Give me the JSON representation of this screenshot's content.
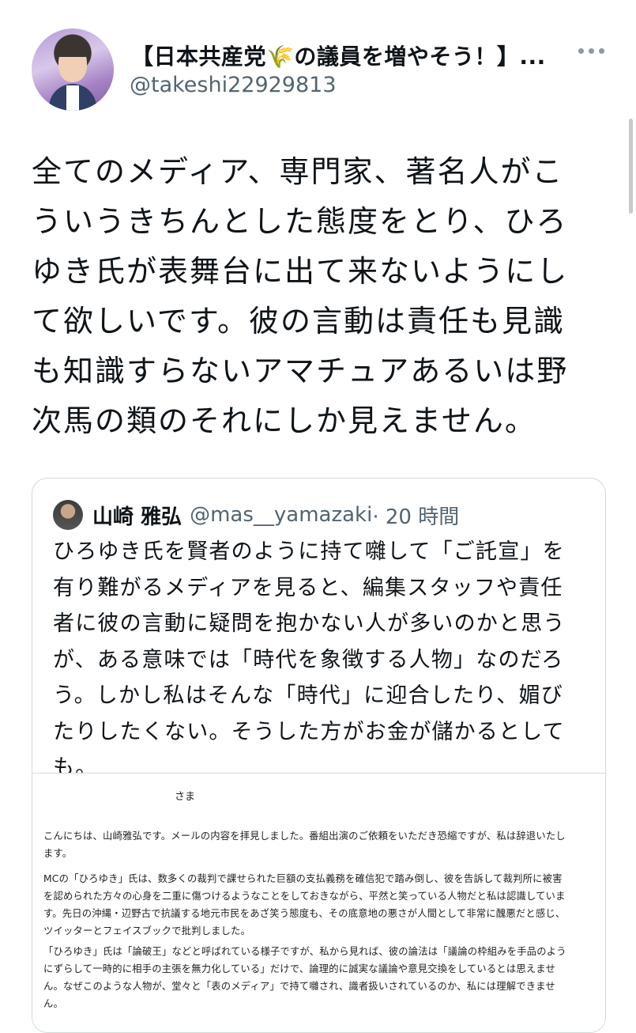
{
  "tweet": {
    "display_name_prefix": "【日本共産党",
    "display_name_emoji": "🌾",
    "display_name_suffix": "の議員を増やそう！】...",
    "handle": "@takeshi22929813",
    "text": "全てのメディア、専門家、著名人がこ\nういうきちんとした態度をとり、ひろ\nゆき氏が表舞台に出て来ないようにし\nて欲しいです。彼の言動は責任も見識\nも知識すらないアマチュアあるいは野\n次馬の類のそれにしか見えません。"
  },
  "quote": {
    "name": "山崎 雅弘",
    "handle": "@mas__yamazaki",
    "time": "· 20 時間",
    "text": "ひろゆき氏を賢者のように持て囃して「ご託宣」を\n有り難がるメディアを見ると、編集スタッフや責任\n者に彼の言動に疑問を抱かない人が多いのかと思う\nが、ある意味では「時代を象徴する人物」なのだろ\nう。しかし私はそんな「時代」に迎合したり、媚び\nたりしたくない。そうした方がお金が儲かるとして\nも。"
  },
  "letter": {
    "salutation": "さま",
    "para1": "こんにちは、山崎雅弘です。メールの内容を拝見しました。番組出演のご依頼をいただき恐縮ですが、私は辞退いたし\nます。",
    "para2": "MCの「ひろゆき」氏は、数多くの裁判で課せられた巨額の支払義務を確信犯で踏み倒し、彼を告訴して裁判所に被害\nを認められた方々の心身を二重に傷つけるようなことをしておきながら、平然と笑っている人物だと私は認識していま\nす。先日の沖縄・辺野古で抗議する地元市民をあざ笑う態度も、その底意地の悪さが人間として非常に醜悪だと感じ、\nツイッターとフェイスブックで批判しました。",
    "para3": "「ひろゆき」氏は「論破王」などと呼ばれている様子ですが、私から見れば、彼の論法は「議論の枠組みを手品のよう\nにずらして一時的に相手の主張を無力化している」だけで、論理的に誠実な議論や意見交換をしているとは思えませ\nん。なぜこのような人物が、堂々と「表のメディア」で持て囃され、識者扱いされているのか、私には理解できませ\nん。"
  }
}
